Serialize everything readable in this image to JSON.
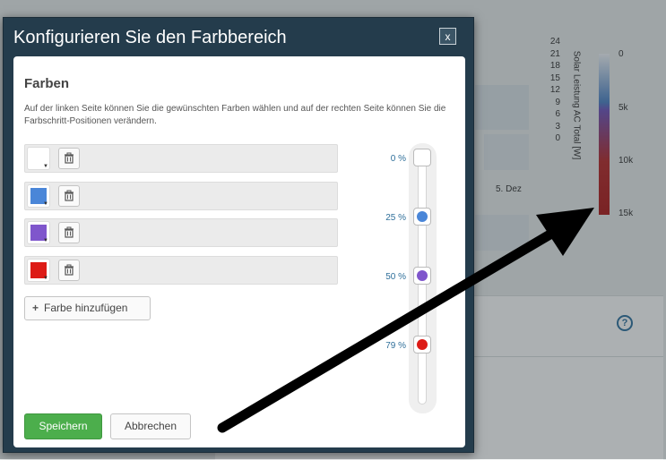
{
  "background": {
    "y_ticks": [
      "24",
      "21",
      "18",
      "15",
      "12",
      "9",
      "6",
      "3",
      "0"
    ],
    "y_axis_title": "Solar Leistung AC Total [W]",
    "colorbar_ticks": [
      "0",
      "5k",
      "10k",
      "15k"
    ],
    "date_label": "5. Dez",
    "help_icon": "?"
  },
  "modal": {
    "title": "Konfigurieren Sie den Farbbereich",
    "close_label": "x",
    "section_title": "Farben",
    "description": "Auf der linken Seite können Sie die gewünschten Farben wählen und auf der rechten Seite können Sie die Farbschritt-Positionen verändern.",
    "colors": [
      {
        "hex": "#ffffff",
        "icon": "trash-icon"
      },
      {
        "hex": "#4a86d8",
        "icon": "trash-icon"
      },
      {
        "hex": "#7f56cc",
        "icon": "trash-icon"
      },
      {
        "hex": "#dd1b16",
        "icon": "trash-icon"
      }
    ],
    "add_color_label": "Farbe hinzufügen",
    "stops": [
      {
        "label": "0 %",
        "position": 0,
        "hex": "#ffffff"
      },
      {
        "label": "25 %",
        "position": 25,
        "hex": "#4a86d8"
      },
      {
        "label": "50 %",
        "position": 50,
        "hex": "#7f56cc"
      },
      {
        "label": "79 %",
        "position": 79,
        "hex": "#dd1b16"
      }
    ],
    "save_label": "Speichern",
    "cancel_label": "Abbrechen"
  }
}
